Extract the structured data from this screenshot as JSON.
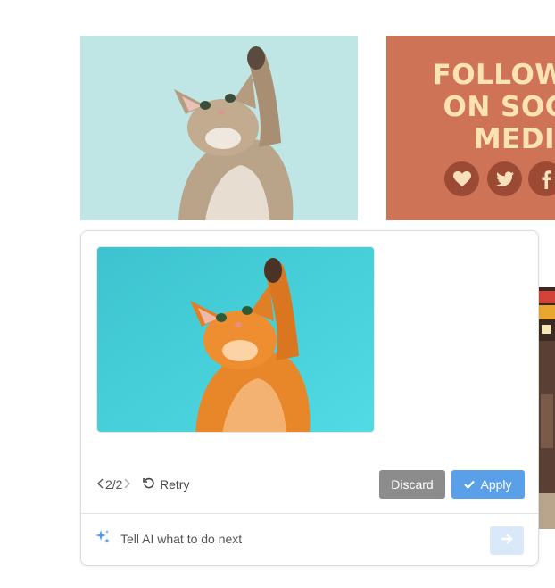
{
  "canvas": {
    "follow_card": {
      "lines": [
        "FOLLOW",
        "ON SOC",
        "MEDI"
      ],
      "social_icons": [
        "heart-icon",
        "twitter-icon",
        "facebook-icon"
      ]
    }
  },
  "ai_panel": {
    "pager": {
      "prev_icon": "chevron-left-icon",
      "current": "2/2",
      "next_icon": "chevron-right-icon"
    },
    "retry_label": "Retry",
    "discard_label": "Discard",
    "apply_label": "Apply",
    "prompt": {
      "placeholder": "Tell AI what to do next",
      "value": ""
    },
    "colors": {
      "apply": "#5aa0e8",
      "discard": "#8c8c8c",
      "send": "#d9e9fa"
    }
  }
}
